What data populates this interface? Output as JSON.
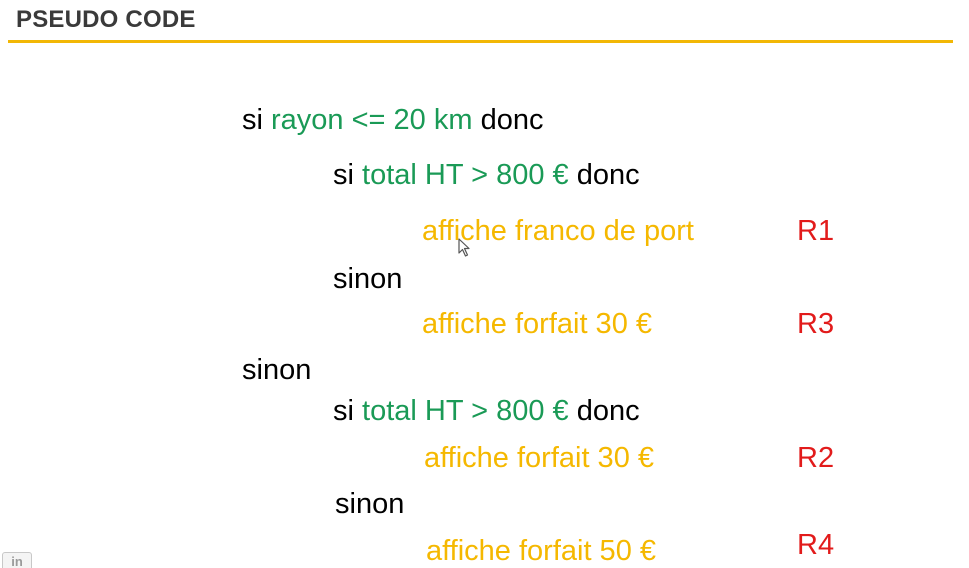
{
  "slide": {
    "title": "PSEUDO CODE"
  },
  "code": {
    "line1": {
      "kw_si": "si",
      "cond": "rayon <= 20 km",
      "kw_donc": "donc"
    },
    "line2": {
      "kw_si": "si",
      "cond": "total HT > 800 €",
      "kw_donc": "donc"
    },
    "line3": {
      "action": "affiche franco de port",
      "rule": "R1"
    },
    "line4": {
      "kw_sinon": "sinon"
    },
    "line5": {
      "action": "affiche forfait 30 €",
      "rule": "R3"
    },
    "line6": {
      "kw_sinon": "sinon"
    },
    "line7": {
      "kw_si": "si",
      "cond": "total HT > 800 €",
      "kw_donc": "donc"
    },
    "line8": {
      "action": "affiche forfait 30 €",
      "rule": "R2"
    },
    "line9": {
      "kw_sinon": "sinon"
    },
    "line10": {
      "action": "affiche forfait 50 €",
      "rule": "R4"
    }
  },
  "icons": {
    "cursor": "mouse-pointer-icon",
    "badge": "linkedin-badge-icon"
  },
  "colors": {
    "title_rule": "#f2b705",
    "condition": "#1a9a56",
    "action": "#f5b800",
    "rule_label": "#e21b1b",
    "keyword": "#000000"
  }
}
